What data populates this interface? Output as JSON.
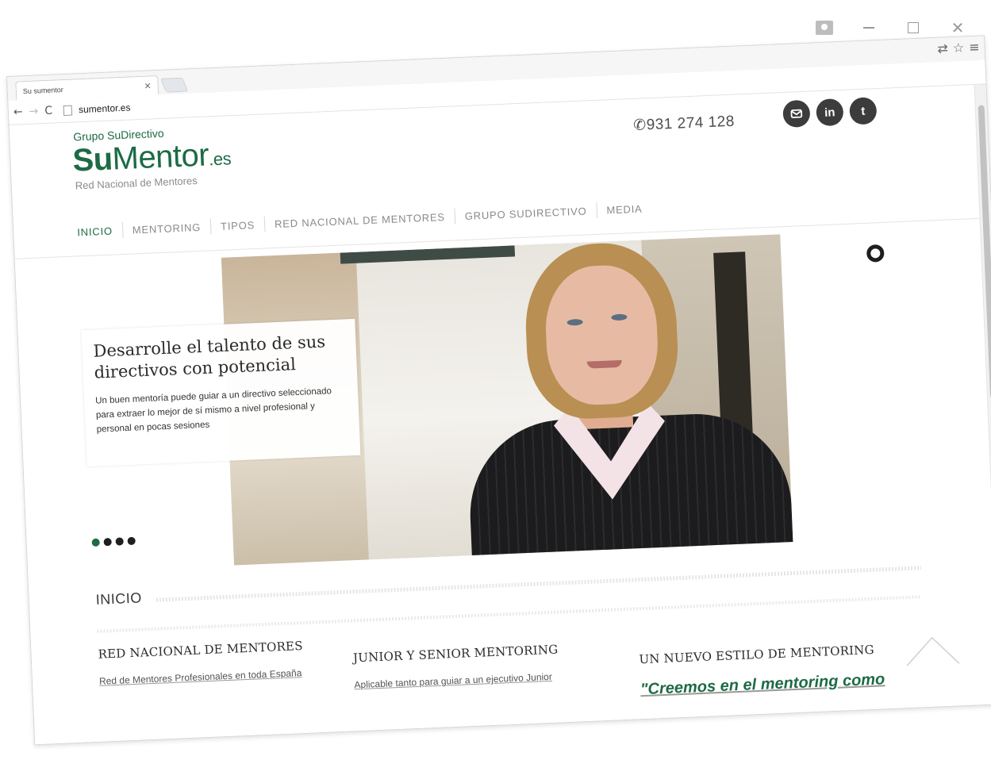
{
  "window": {
    "user_icon": "user-icon",
    "minimize_icon": "minimize-icon",
    "maximize_icon": "maximize-icon",
    "close_glyph": "✕"
  },
  "browser": {
    "tab_title": "Su sumentor",
    "tab_close": "×",
    "url": "sumentor.es",
    "back": "←",
    "forward": "→",
    "reload": "C",
    "translate_icon": "translate-icon",
    "star": "☆",
    "menu": "≡"
  },
  "header": {
    "group": "Grupo SuDirectivo",
    "logo_su": "Su",
    "logo_mentor": "Mentor",
    "logo_es": ".es",
    "tagline": "Red Nacional de Mentores",
    "phone": "✆931 274 128",
    "social": [
      "mail-icon",
      "linkedin-icon",
      "twitter-icon"
    ]
  },
  "nav": {
    "items": [
      "INICIO",
      "MENTORING",
      "TIPOS",
      "RED NACIONAL DE MENTORES",
      "GRUPO SUDIRECTIVO",
      "MEDIA"
    ],
    "active_index": 0
  },
  "hero": {
    "title": "Desarrolle el talento de sus directivos con potencial",
    "text": "Un buen mentoría puede guiar a un directivo seleccionado para extraer lo mejor de sí mismo a nivel profesional y personal en pocas sesiones",
    "slides": 4,
    "active_slide": 0
  },
  "section": {
    "title": "INICIO"
  },
  "columns": [
    {
      "heading": "RED NACIONAL DE MENTORES",
      "text": "Red de Mentores Profesionales en toda España"
    },
    {
      "heading": "JUNIOR Y SENIOR MENTORING",
      "text": "Aplicable tanto para guiar a un ejecutivo Junior"
    },
    {
      "heading": "UN NUEVO ESTILO DE MENTORING",
      "text": "\"Creemos en el mentoring como"
    }
  ],
  "colors": {
    "brand_green": "#1d6b45",
    "text_dark": "#2a2a2a",
    "nav_gray": "#8a8a8a",
    "social_bg": "#3c3c3c"
  }
}
